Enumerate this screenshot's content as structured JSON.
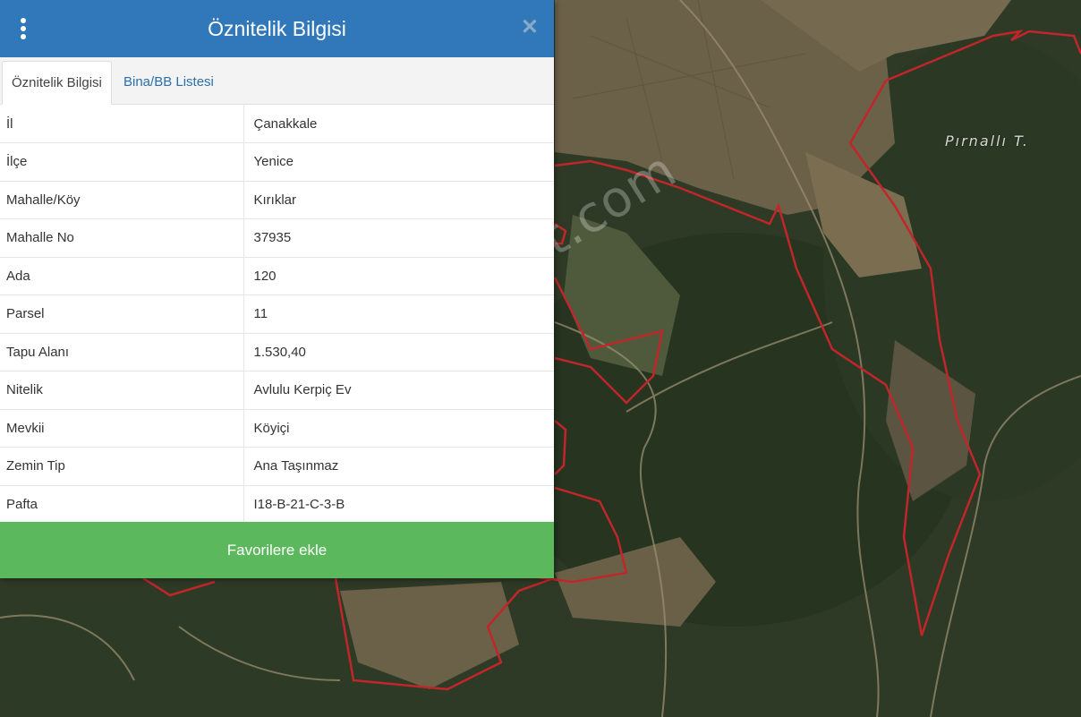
{
  "panel": {
    "title": "Öznitelik Bilgisi",
    "tabs": [
      {
        "label": "Öznitelik Bilgisi",
        "active": true
      },
      {
        "label": "Bina/BB Listesi",
        "active": false
      }
    ],
    "rows": [
      {
        "key": "İl",
        "value": "Çanakkale"
      },
      {
        "key": "İlçe",
        "value": "Yenice"
      },
      {
        "key": "Mahalle/Köy",
        "value": "Kırıklar"
      },
      {
        "key": "Mahalle No",
        "value": "37935"
      },
      {
        "key": "Ada",
        "value": "120"
      },
      {
        "key": "Parsel",
        "value": "11"
      },
      {
        "key": "Tapu Alanı",
        "value": "1.530,40"
      },
      {
        "key": "Nitelik",
        "value": "Avlulu Kerpiç Ev"
      },
      {
        "key": "Mevkii",
        "value": "Köyiçi"
      },
      {
        "key": "Zemin Tip",
        "value": "Ana Taşınmaz"
      },
      {
        "key": "Pafta",
        "value": "I18-B-21-C-3-B"
      }
    ],
    "favorite_button": "Favorilere ekle"
  },
  "map": {
    "place_label": "Pırnallı T.",
    "watermark": "emlakjet.com"
  },
  "colors": {
    "header": "#3178ba",
    "button": "#5cb85c",
    "parcel_border": "#c0262a"
  },
  "icons": {
    "menu": "vertical-ellipsis-icon",
    "close": "close-icon"
  }
}
